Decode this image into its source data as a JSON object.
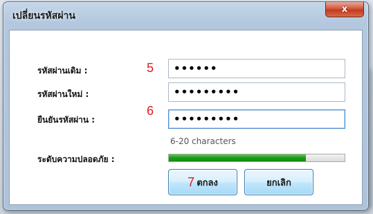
{
  "window": {
    "title": "เปลี่ยนรหัสผ่าน",
    "close_glyph": "x"
  },
  "form": {
    "old_password": {
      "label": "รหัสผ่านเดิม :",
      "value": "••••••",
      "step": "5"
    },
    "new_password": {
      "label": "รหัสผ่านใหม่ :",
      "value": "•••••••••"
    },
    "confirm_password": {
      "label": "ยืนยันรหัสผ่าน :",
      "value": "•••••••••",
      "step": "6"
    },
    "hint": "6-20 characters",
    "strength": {
      "label": "ระดับความปลอดภัย :",
      "level_fraction": 0.78,
      "color": "#1b9b16"
    }
  },
  "buttons": {
    "ok": {
      "label": "ตกลง",
      "step": "7"
    },
    "cancel": {
      "label": "ยกเลิก"
    }
  },
  "colors": {
    "step_marker": "#e11b1b",
    "close_button": "#c43b20",
    "button_border": "#3c7fb1"
  }
}
